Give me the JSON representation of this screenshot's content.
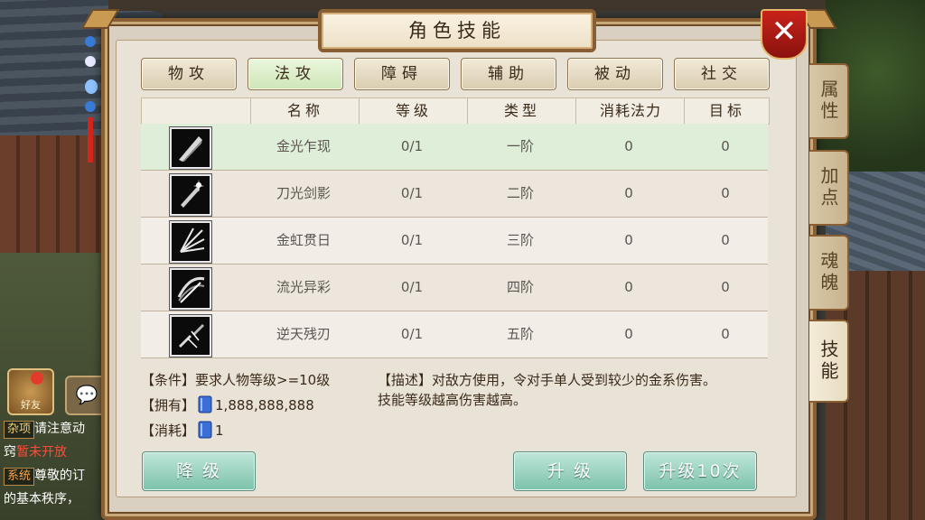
{
  "window": {
    "title": "角色技能"
  },
  "category_tabs": [
    {
      "label": "物攻",
      "active": false
    },
    {
      "label": "法攻",
      "active": true
    },
    {
      "label": "障碍",
      "active": false
    },
    {
      "label": "辅助",
      "active": false
    },
    {
      "label": "被动",
      "active": false
    },
    {
      "label": "社交",
      "active": false
    }
  ],
  "side_tabs": [
    {
      "label": "属性",
      "active": false
    },
    {
      "label": "加点",
      "active": false
    },
    {
      "label": "魂魄",
      "active": false
    },
    {
      "label": "技能",
      "active": true
    }
  ],
  "table": {
    "headers": [
      "名称",
      "等级",
      "类型",
      "消耗法力",
      "目标"
    ],
    "rows": [
      {
        "name": "金光乍现",
        "level": "0/1",
        "type": "一阶",
        "mana": "0",
        "target": "0",
        "icon": "blade-icon",
        "selected": true
      },
      {
        "name": "刀光剑影",
        "level": "0/1",
        "type": "二阶",
        "mana": "0",
        "target": "0",
        "icon": "sparkle-blade-icon",
        "selected": false
      },
      {
        "name": "金虹贯日",
        "level": "0/1",
        "type": "三阶",
        "mana": "0",
        "target": "0",
        "icon": "burst-icon",
        "selected": false
      },
      {
        "name": "流光异彩",
        "level": "0/1",
        "type": "四阶",
        "mana": "0",
        "target": "0",
        "icon": "swirl-blade-icon",
        "selected": false
      },
      {
        "name": "逆天残刃",
        "level": "0/1",
        "type": "五阶",
        "mana": "0",
        "target": "0",
        "icon": "broken-blade-icon",
        "selected": false
      }
    ]
  },
  "info": {
    "condition": "【条件】要求人物等级>=10级",
    "owned_label": "【拥有】",
    "owned_value": "1,888,888,888",
    "cost_label": "【消耗】",
    "cost_value": "1",
    "description": "【描述】对敌方使用，令对手单人受到较少的金系伤害。",
    "description2": "技能等级越高伤害越高。"
  },
  "buttons": {
    "downgrade": "降  级",
    "upgrade": "升  级",
    "upgrade10": "升级10次"
  },
  "close_label": "✕",
  "chat": {
    "friend_label": "好友",
    "line1_tag": "杂项",
    "line1_text": "请注意动",
    "line2_prefix": "窍",
    "line2_warn": "暂未开放",
    "line3_tag": "系统",
    "line3_text": "尊敬的订",
    "line4_text": "的基本秩序，"
  },
  "colors": {
    "accent_green": "#7cc2ab",
    "frame_brown": "#8a5e33",
    "close_red": "#c8221a"
  }
}
